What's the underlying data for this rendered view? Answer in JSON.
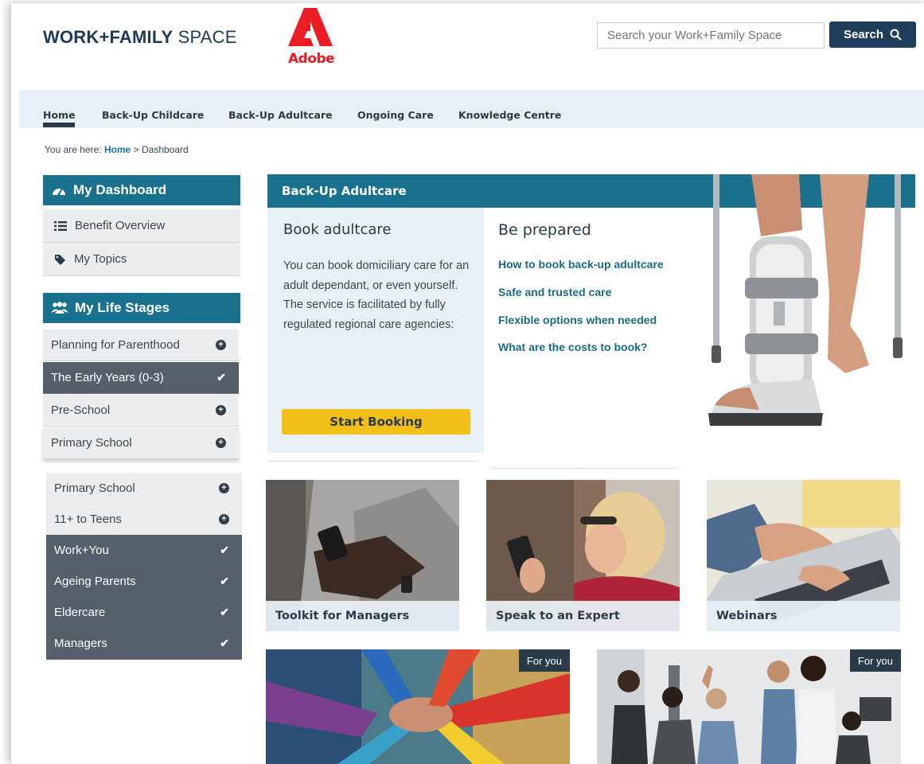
{
  "header": {
    "logo_bold": "WORK+FAMILY",
    "logo_thin": " SPACE",
    "partner_logo_text": "Adobe",
    "search_placeholder": "Search your Work+Family Space",
    "search_label": "Search"
  },
  "nav": {
    "items": [
      "Home",
      "Back-Up Childcare",
      "Back-Up Adultcare",
      "Ongoing Care",
      "Knowledge Centre"
    ],
    "active": "Home"
  },
  "breadcrumb": {
    "prefix": "You are here: ",
    "home": "Home",
    "sep": " > ",
    "current": "Dashboard"
  },
  "sidebar": {
    "dashboard_title": "My Dashboard",
    "dashboard_items": [
      "Benefit Overview",
      "My Topics"
    ],
    "life_stages_title": "My Life Stages",
    "stages_top": [
      {
        "label": "Planning for Parenthood",
        "state": "add"
      },
      {
        "label": "The Early Years (0-3)",
        "state": "selected"
      },
      {
        "label": "Pre-School",
        "state": "add"
      },
      {
        "label": "Primary School",
        "state": "add"
      }
    ],
    "stages_bottom": [
      {
        "label": "Primary School",
        "state": "add"
      },
      {
        "label": "11+ to Teens",
        "state": "add"
      },
      {
        "label": "Work+You",
        "state": "selected"
      },
      {
        "label": "Ageing Parents",
        "state": "selected"
      },
      {
        "label": "Eldercare",
        "state": "selected"
      },
      {
        "label": "Managers",
        "state": "selected"
      }
    ]
  },
  "panel": {
    "title": "Back-Up Adultcare",
    "book_title": "Book adultcare",
    "book_text": "You can book domiciliary care for an adult dependant, or even yourself. The service is facilitated by fully regulated regional care agencies:",
    "start_label": "Start Booking",
    "prep_title": "Be prepared",
    "prep_links": [
      "How to book back-up adultcare",
      "Safe and trusted care",
      "Flexible options when needed",
      "What are the costs to book?"
    ]
  },
  "tiles": [
    {
      "caption": "Toolkit for Managers"
    },
    {
      "caption": "Speak to an Expert"
    },
    {
      "caption": "Webinars"
    }
  ],
  "promo_tiles": [
    {
      "badge": "For you"
    },
    {
      "badge": "For you"
    }
  ],
  "colors": {
    "brand_navy": "#1e3e5c",
    "teal": "#19718e",
    "accent_yellow": "#f2c019",
    "adobe_red": "#ec1c24",
    "stage_dark": "#555f6a"
  }
}
